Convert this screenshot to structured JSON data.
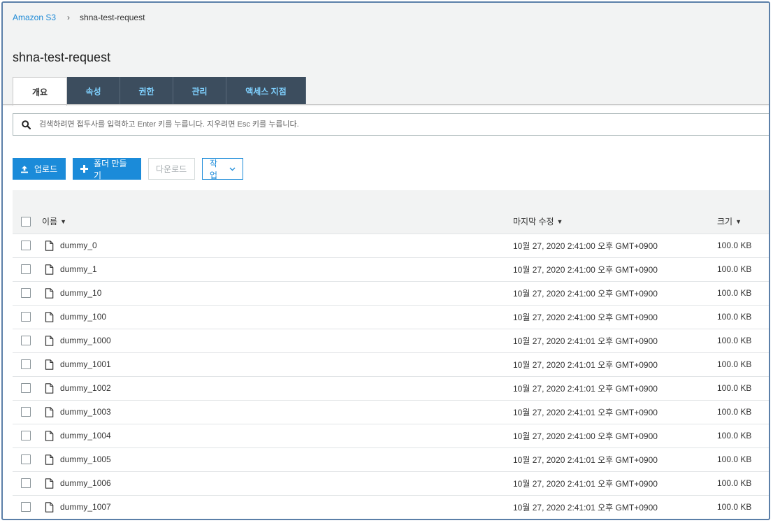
{
  "breadcrumb": {
    "root": "Amazon S3",
    "separator": "›",
    "current": "shna-test-request"
  },
  "page": {
    "title": "shna-test-request"
  },
  "tabs": [
    {
      "label": "개요",
      "active": true
    },
    {
      "label": "속성",
      "active": false
    },
    {
      "label": "권한",
      "active": false
    },
    {
      "label": "관리",
      "active": false
    },
    {
      "label": "액세스 지점",
      "active": false
    }
  ],
  "search": {
    "placeholder": "검색하려면 접두사를 입력하고 Enter 키를 누릅니다. 지우려면 Esc 키를 누릅니다.",
    "value": "",
    "icon": "search-icon"
  },
  "toolbar": {
    "upload_label": "업로드",
    "create_folder_label": "폴더 만들기",
    "download_label": "다운로드",
    "actions_label": "작업"
  },
  "table": {
    "headers": {
      "name": "이름",
      "modified": "마지막 수정",
      "size": "크기"
    },
    "rows": [
      {
        "name": "dummy_0",
        "modified": "10월 27, 2020 2:41:00 오후 GMT+0900",
        "size": "100.0 KB"
      },
      {
        "name": "dummy_1",
        "modified": "10월 27, 2020 2:41:00 오후 GMT+0900",
        "size": "100.0 KB"
      },
      {
        "name": "dummy_10",
        "modified": "10월 27, 2020 2:41:00 오후 GMT+0900",
        "size": "100.0 KB"
      },
      {
        "name": "dummy_100",
        "modified": "10월 27, 2020 2:41:00 오후 GMT+0900",
        "size": "100.0 KB"
      },
      {
        "name": "dummy_1000",
        "modified": "10월 27, 2020 2:41:01 오후 GMT+0900",
        "size": "100.0 KB"
      },
      {
        "name": "dummy_1001",
        "modified": "10월 27, 2020 2:41:01 오후 GMT+0900",
        "size": "100.0 KB"
      },
      {
        "name": "dummy_1002",
        "modified": "10월 27, 2020 2:41:01 오후 GMT+0900",
        "size": "100.0 KB"
      },
      {
        "name": "dummy_1003",
        "modified": "10월 27, 2020 2:41:01 오후 GMT+0900",
        "size": "100.0 KB"
      },
      {
        "name": "dummy_1004",
        "modified": "10월 27, 2020 2:41:00 오후 GMT+0900",
        "size": "100.0 KB"
      },
      {
        "name": "dummy_1005",
        "modified": "10월 27, 2020 2:41:01 오후 GMT+0900",
        "size": "100.0 KB"
      },
      {
        "name": "dummy_1006",
        "modified": "10월 27, 2020 2:41:01 오후 GMT+0900",
        "size": "100.0 KB"
      },
      {
        "name": "dummy_1007",
        "modified": "10월 27, 2020 2:41:01 오후 GMT+0900",
        "size": "100.0 KB"
      }
    ]
  },
  "colors": {
    "accent": "#1b8bd9",
    "tab_dark": "#3c4d5e",
    "tab_text": "#7fd1ff",
    "frame_border": "#5b7fa8"
  }
}
